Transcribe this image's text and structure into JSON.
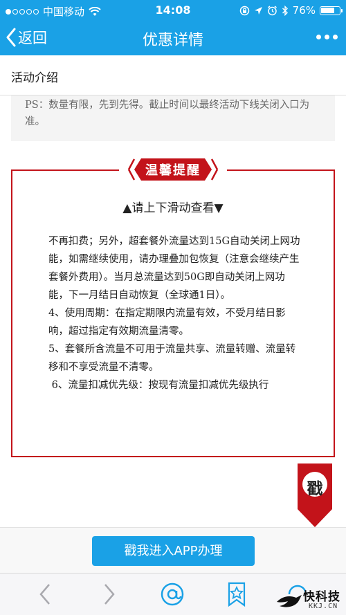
{
  "status_bar": {
    "carrier": "中国移动",
    "time": "14:08",
    "battery": "76%",
    "battery_level": 0.76,
    "icons": [
      "signal-dots",
      "wifi-icon",
      "lock-rotation-icon",
      "location-arrow-icon",
      "alarm-icon",
      "bluetooth-icon",
      "battery-icon"
    ]
  },
  "nav": {
    "back_label": "返回",
    "title": "优惠详情",
    "more_icon": "more-icon"
  },
  "section": {
    "title": "活动介绍"
  },
  "ps_text": "PS：数量有限，先到先得。截止时间以最终活动下线关闭入口为准。",
  "reminder": {
    "badge": "温馨提醒",
    "scroll_hint": "▲请上下滑动查看▼",
    "paragraphs": [
      "不再扣费；另外，超套餐外流量达到15G自动关闭上网功能，如需继续使用，请办理叠加包恢复（注意会继续产生套餐外费用）。当月总流量达到50G即自动关闭上网功能，下一月结日自动恢复（全球通1日）。",
      "4、使用周期：在指定期限内流量有效，不受月结日影响，超过指定有效期流量清零。",
      "5、套餐所含流量不可用于流量共享、流量转赠、流量转移和不享受流量不清零。",
      " 6、流量扣减优先级：按现有流量扣减优先级执行"
    ],
    "border_color": "#c3131a"
  },
  "ribbon": {
    "char": "戳"
  },
  "cta": {
    "label": "戳我进入APP办理"
  },
  "toolbar": {
    "icons": [
      "back-arrow-icon",
      "forward-arrow-icon",
      "at-sign-icon",
      "bookmark-star-icon"
    ]
  },
  "watermark": {
    "title": "快科技",
    "subtitle": "KKJ.CN"
  },
  "colors": {
    "accent": "#1aa1e6",
    "alert_red": "#c3131a"
  }
}
